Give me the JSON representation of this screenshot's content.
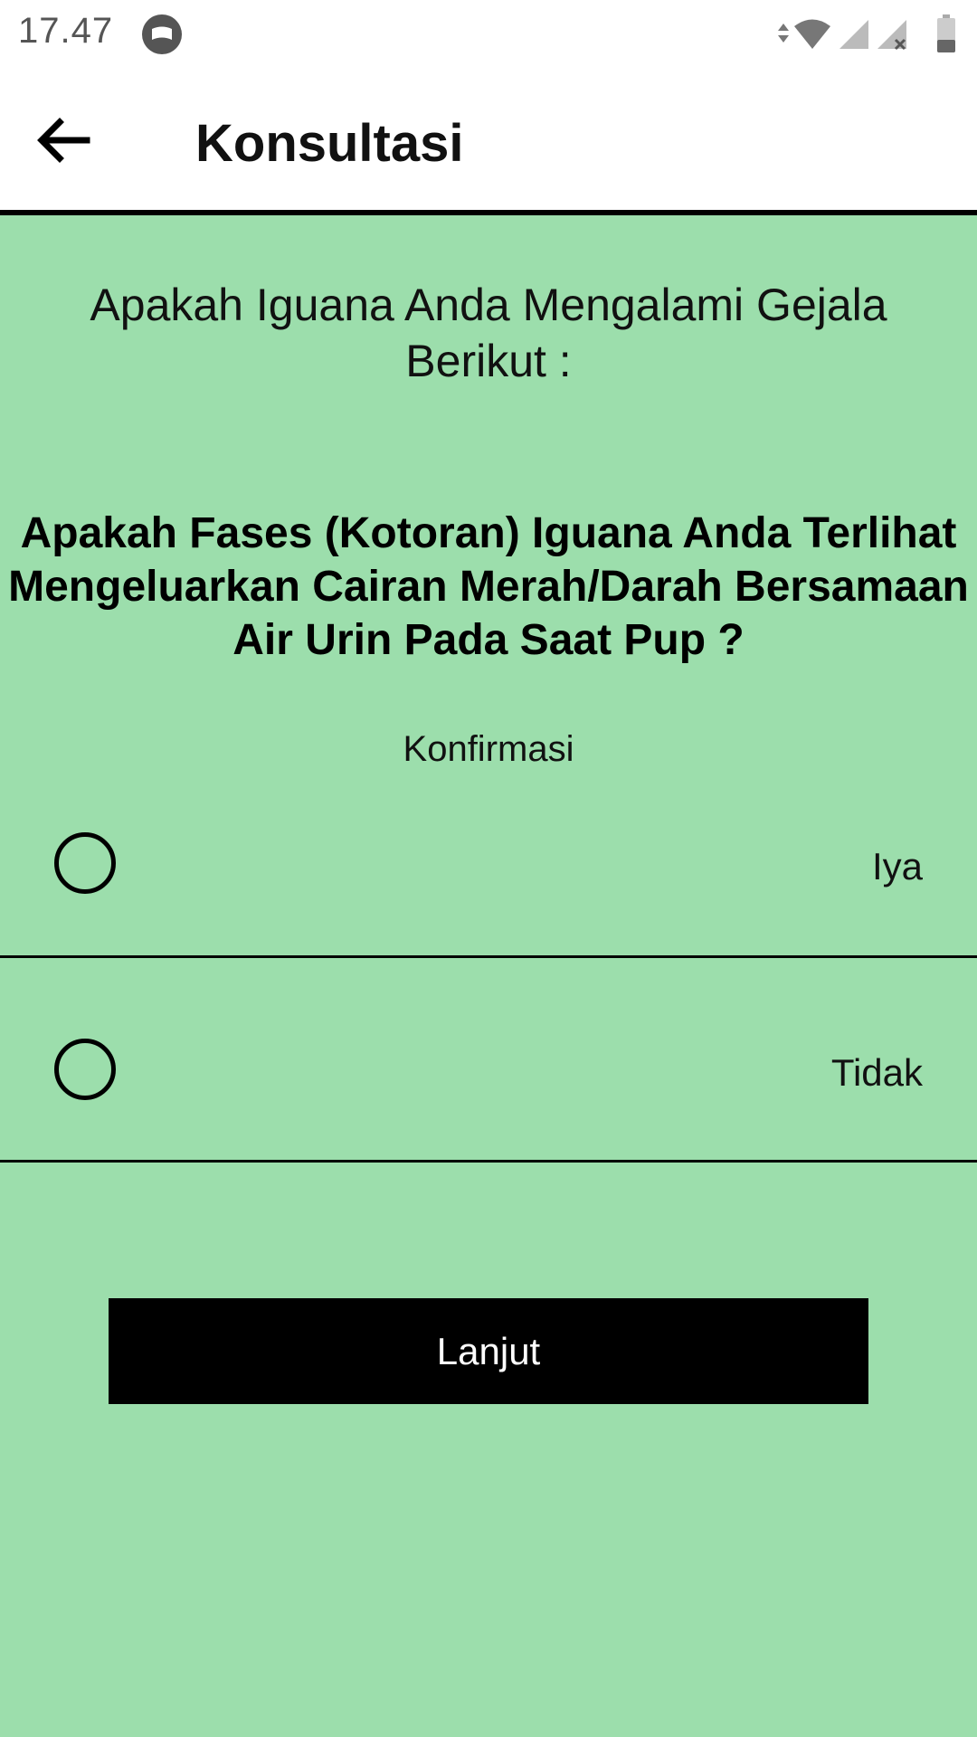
{
  "status_bar": {
    "time": "17.47",
    "icons": [
      "notification-icon",
      "data-arrows-icon",
      "wifi-icon",
      "signal-icon",
      "signal-no-sim-icon",
      "battery-icon"
    ]
  },
  "app_bar": {
    "title": "Konsultasi",
    "back_icon": "arrow-back-icon"
  },
  "content": {
    "heading": "Apakah Iguana Anda Mengalami Gejala Berikut :",
    "question": "Apakah Fases (Kotoran) Iguana Anda Terlihat Mengeluarkan Cairan Merah/Darah Bersamaan Air Urin Pada Saat Pup ?",
    "confirm_label": "Konfirmasi",
    "options": [
      {
        "label": "Iya",
        "selected": false
      },
      {
        "label": "Tidak",
        "selected": false
      }
    ],
    "next_label": "Lanjut"
  },
  "colors": {
    "background": "#9cdeac",
    "app_bar": "#ffffff",
    "button": "#000000",
    "button_text": "#ffffff"
  }
}
